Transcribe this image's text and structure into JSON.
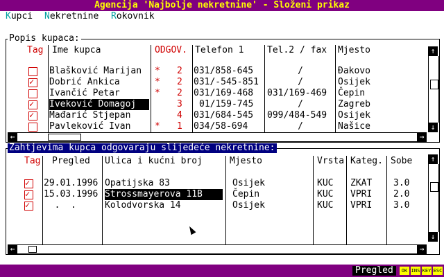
{
  "window": {
    "title": "Agencija 'Najbolje nekretnine' - Složeni prikaz"
  },
  "menu": [
    {
      "hot": "K",
      "rest": "upci"
    },
    {
      "hot": "N",
      "rest": "ekretnine"
    },
    {
      "hot": "R",
      "rest": "okovnik"
    }
  ],
  "buyers_panel": {
    "title": "Popis kupaca:",
    "headers": {
      "tag": "Tag",
      "name": "Ime kupca",
      "odgov": "ODGOV.",
      "phone1": "Telefon 1",
      "phone2": "Tel.2 / fax",
      "place": "Mjesto"
    },
    "rows": [
      {
        "tag": false,
        "name": "Blašković Marijan",
        "star": "*",
        "odgov": "2",
        "phone1": "031/858-645",
        "phone2": "/",
        "place": "Đakovo"
      },
      {
        "tag": true,
        "name": "Dobrić Ankica",
        "star": "*",
        "odgov": "2",
        "phone1": "031/-545-851",
        "phone2": "/",
        "place": "Osijek"
      },
      {
        "tag": false,
        "name": "Ivančić Petar",
        "star": "*",
        "odgov": "2",
        "phone1": "031/169-468",
        "phone2": "031/169-469",
        "place": "Čepin"
      },
      {
        "tag": true,
        "name": "Iveković Domagoj",
        "star": "",
        "odgov": "3",
        "phone1": "01/159-745",
        "phone2": "/",
        "place": "Zagreb"
      },
      {
        "tag": true,
        "name": "Mađarić Stjepan",
        "star": "",
        "odgov": "4",
        "phone1": "031/684-545",
        "phone2": "099/484-549",
        "place": "Osijek"
      },
      {
        "tag": false,
        "name": "Pavleković Ivan",
        "star": "*",
        "odgov": "1",
        "phone1": "034/58-694",
        "phone2": "/",
        "place": "Našice"
      }
    ]
  },
  "matches_panel": {
    "title": "Zahtjevima kupca odgovaraju slijedeće nekretnine:",
    "headers": {
      "tag": "Tag",
      "review": "Pregled",
      "street": "Ulica i kućni broj",
      "place": "Mjesto",
      "type": "Vrsta",
      "category": "Kateg.",
      "rooms": "Sobe"
    },
    "rows": [
      {
        "tag": true,
        "review": "29.01.1996",
        "street": "Opatijska 83",
        "place": "Osijek",
        "type": "KUC",
        "category": "ZKAT",
        "rooms": "3.0"
      },
      {
        "tag": true,
        "review": "15.03.1996",
        "street": "Strossmayerova 11B",
        "place": "Čepin",
        "type": "KUC",
        "category": "VPRI",
        "rooms": "2.0"
      },
      {
        "tag": true,
        "review": "  .  .",
        "street": "Kolodvorska 14",
        "place": "Osijek",
        "type": "KUC",
        "category": "VPRI",
        "rooms": "3.0"
      }
    ]
  },
  "scroll_icons": {
    "up": "↑",
    "down": "↓",
    "left": "←",
    "right": "→"
  },
  "status": {
    "mode": "Pregled",
    "keys": [
      "OK",
      "INS",
      "KEY",
      "ESC"
    ]
  }
}
